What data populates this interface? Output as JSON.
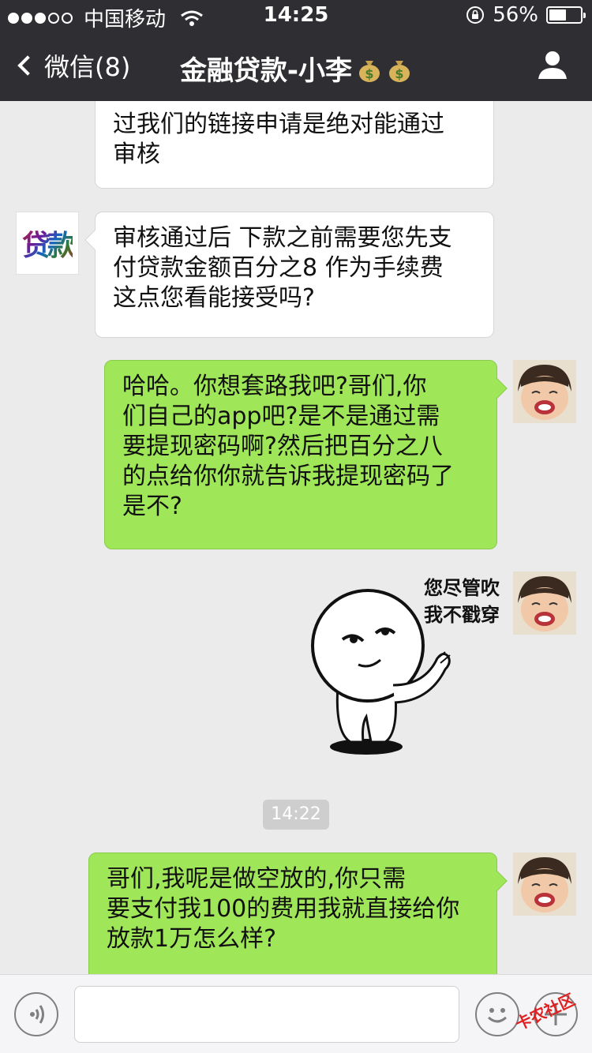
{
  "status_bar": {
    "carrier": "中国移动",
    "time": "14:25",
    "battery_text": "56%",
    "battery_level": 0.56
  },
  "nav": {
    "back_label": "微信(8)",
    "title": "金融贷款-小李"
  },
  "messages": [
    {
      "side": "left",
      "text": "过我们的链接申请是绝对能通过\n审核"
    },
    {
      "side": "left",
      "avatar_text": "贷款",
      "text": "审核通过后 下款之前需要您先支\n付贷款金额百分之8 作为手续费\n这点您看能接受吗?"
    },
    {
      "side": "right",
      "text": "哈哈。你想套路我吧?哥们,你\n们自己的app吧?是不是通过需\n要提现密码啊?然后把百分之八\n的点给你你就告诉我提现密码了\n是不?"
    },
    {
      "side": "right",
      "sticker_caption": "您尽管吹\n我不戳穿"
    },
    {
      "side": "right",
      "text": "哥们,我呢是做空放的,你只需\n要支付我100的费用我就直接给你\n放款1万怎么样?"
    }
  ],
  "timestamp": "14:22",
  "watermark": "卡农社区",
  "colors": {
    "bar": "#2e2e33",
    "chat_bg": "#ebebeb",
    "green_bubble": "#9fe658"
  }
}
